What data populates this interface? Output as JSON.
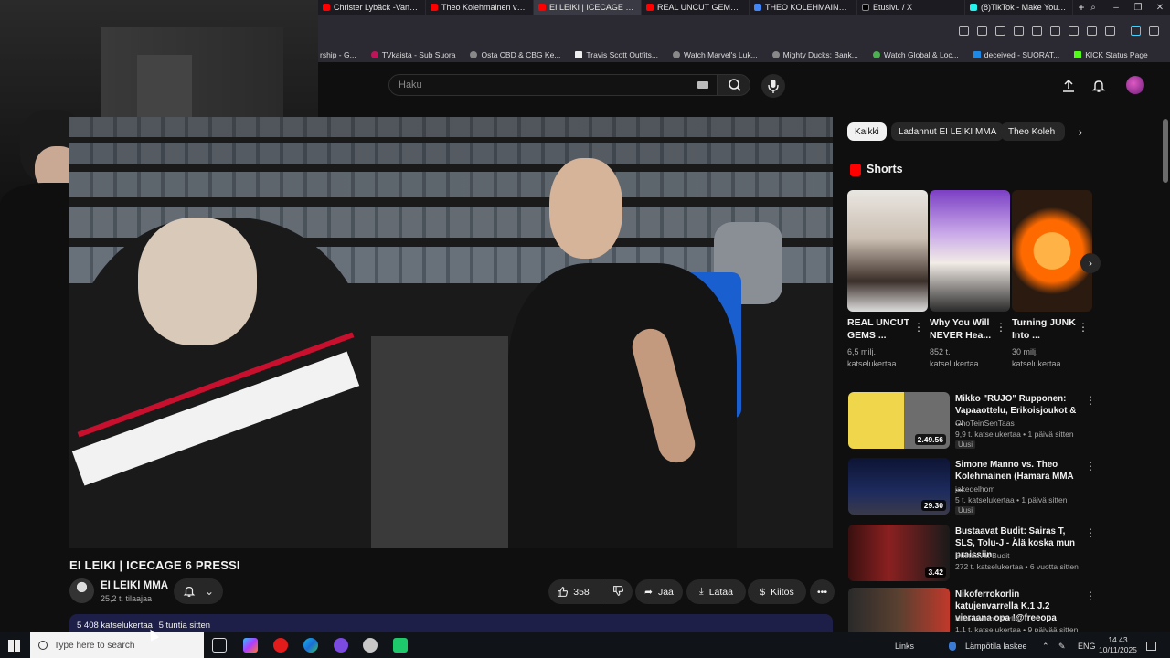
{
  "browser": {
    "tabs": [
      {
        "label": "Christer Lybäck -Vankilast",
        "icon": "youtube-favicon"
      },
      {
        "label": "Theo Kolehmainen vs Ton",
        "icon": "youtube-favicon"
      },
      {
        "label": "EI LEIKI | ICECAGE 6 P",
        "icon": "youtube-favicon",
        "active": true
      },
      {
        "label": "REAL UNCUT GEMS BUS",
        "icon": "youtube-favicon"
      },
      {
        "label": "THEO KOLEHMAINEN - T",
        "icon": "docs-favicon"
      },
      {
        "label": "Etusivu / X",
        "icon": "x-favicon"
      },
      {
        "label": "(8)TikTok - Make Your Da",
        "icon": "tiktok-favicon"
      }
    ],
    "bookmarks": [
      "rship - G...",
      "TVkaista - Sub Suora",
      "Osta CBD & CBG Ke...",
      "Travis Scott Outfits...",
      "Watch Marvel's Luk...",
      "Mighty Ducks: Bank...",
      "Watch Global & Loc...",
      "deceived - SUORAT...",
      "KICK Status Page"
    ]
  },
  "header": {
    "search_placeholder": "Haku"
  },
  "video": {
    "title": "EI LEIKI | ICECAGE 6 PRESSI",
    "channel": "EI LEIKI MMA",
    "subscribers": "25,2 t. tilaajaa",
    "likes": "358",
    "share_label": "Jaa",
    "download_label": "Lataa",
    "thanks_label": "Kiitos",
    "views": "5 408 katselukertaa",
    "age": "5 tuntia sitten"
  },
  "chips": [
    "Kaikki",
    "Ladannut EI LEIKI MMA",
    "Theo Koleh"
  ],
  "shorts": {
    "heading": "Shorts",
    "items": [
      {
        "title": "REAL UNCUT GEMS ...",
        "views": "6,5 milj. katselukertaa"
      },
      {
        "title": "Why You Will NEVER Hea...",
        "views": "852 t. katselukertaa"
      },
      {
        "title": "Turning JUNK Into ...",
        "views": "30 milj. katselukertaa"
      }
    ]
  },
  "recommendations": [
    {
      "title": "Mikko \"RUJO\" Rupponen: Vapaaottelu, Erikoisjoukot & ...",
      "channel": "OhoTeinSenTaas",
      "meta": "9,9 t. katselukertaa • 1 päivä sitten",
      "badge": "Uusi",
      "duration": "2.49.56"
    },
    {
      "title": "Simone Manno vs. Theo Kolehmainen (Hamara MMA ...",
      "channel": "jakedelhom",
      "meta": "5 t. katselukertaa • 1 päivä sitten",
      "badge": "Uusi",
      "duration": "29.30"
    },
    {
      "title": "Bustaavat Budit: Sairas T, SLS, Tolu-J - Älä koska mun praissiin",
      "channel": "Bustaavat Budit",
      "meta": "272 t. katselukertaa • 6 vuotta sitten",
      "badge": "",
      "duration": "3.42"
    },
    {
      "title": "Nikoferrokorlin katujenvarrella K.1 J.2 vieraana opa !@freeopa",
      "channel": "Niko \"Ferro\" Korlin",
      "meta": "1,1 t. katselukertaa • 9 päivää sitten",
      "badge": "",
      "duration": ""
    }
  ],
  "taskbar": {
    "search_placeholder": "Type here to search",
    "links_label": "Links",
    "weather": "Lämpötila laskee",
    "language": "ENG",
    "time": "14.43",
    "date": "10/11/2025"
  }
}
